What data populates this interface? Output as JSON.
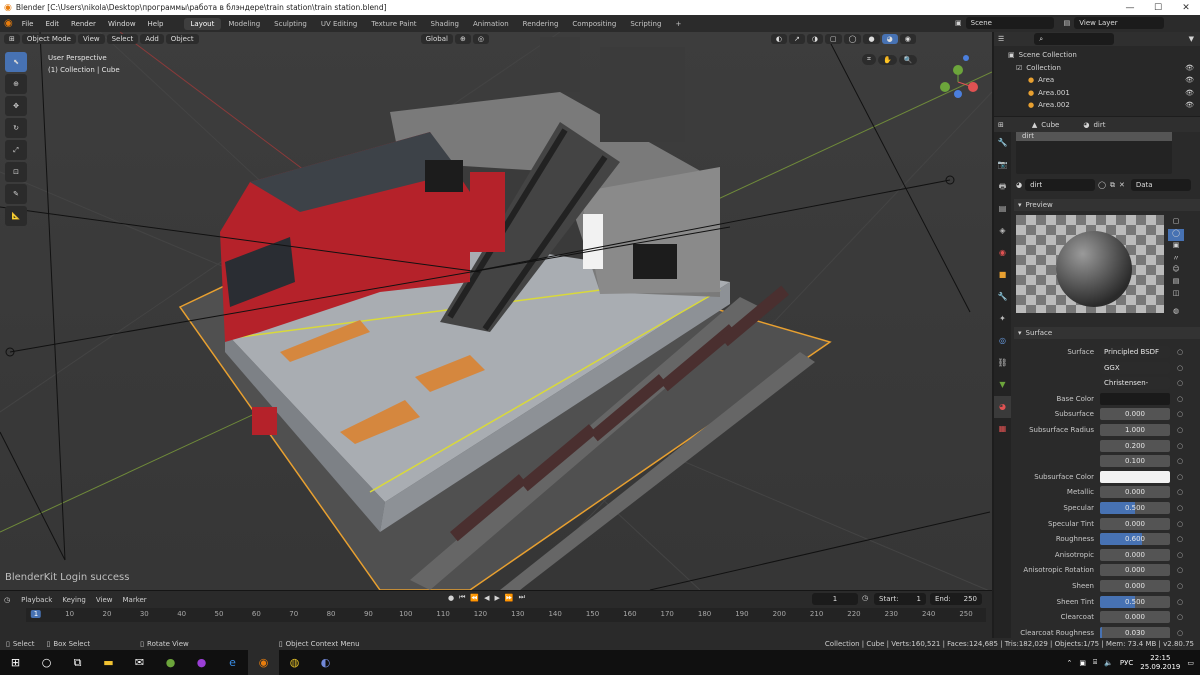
{
  "titlebar": {
    "title": "Blender [C:\\Users\\nikola\\Desktop\\программы\\работа в блэндере\\train station\\train station.blend]",
    "minimize": "—",
    "maximize": "☐",
    "close": "✕"
  },
  "menu": [
    "File",
    "Edit",
    "Render",
    "Window",
    "Help"
  ],
  "workspaces": [
    "Layout",
    "Modeling",
    "Sculpting",
    "UV Editing",
    "Texture Paint",
    "Shading",
    "Animation",
    "Rendering",
    "Compositing",
    "Scripting",
    "+"
  ],
  "scene": {
    "label": "Scene",
    "view_layer": "View Layer"
  },
  "viewport": {
    "mode": "Object Mode",
    "menus": [
      "View",
      "Select",
      "Add",
      "Object"
    ],
    "orientation": "Global",
    "perspective": "User Perspective",
    "collection": "(1) Collection | Cube",
    "notice": "BlenderKit Login success"
  },
  "outliner": {
    "root": "Scene Collection",
    "collection": "Collection",
    "items": [
      "Area",
      "Area.001",
      "Area.002"
    ],
    "search_placeholder": ""
  },
  "properties": {
    "object": "Cube",
    "material": "dirt",
    "slot": "dirt",
    "material_field": "dirt",
    "data_label": "Data",
    "preview_label": "Preview",
    "surface_label": "Surface",
    "rows": [
      {
        "label": "Surface",
        "value": "Principled BSDF",
        "kind": "dropdown"
      },
      {
        "label": "",
        "value": "GGX",
        "kind": "dropdown"
      },
      {
        "label": "",
        "value": "Christensen-Burley",
        "kind": "dropdown"
      },
      {
        "label": "Base Color",
        "value": "",
        "kind": "swatch-dark"
      },
      {
        "label": "Subsurface",
        "value": "0.000",
        "kind": "num",
        "fill": 0
      },
      {
        "label": "Subsurface Radius",
        "value": "1.000",
        "kind": "num",
        "fill": 0
      },
      {
        "label": "",
        "value": "0.200",
        "kind": "num",
        "fill": 0
      },
      {
        "label": "",
        "value": "0.100",
        "kind": "num",
        "fill": 0
      },
      {
        "label": "Subsurface Color",
        "value": "",
        "kind": "swatch-light"
      },
      {
        "label": "Metallic",
        "value": "0.000",
        "kind": "num",
        "fill": 0
      },
      {
        "label": "Specular",
        "value": "0.500",
        "kind": "num",
        "fill": 0.5
      },
      {
        "label": "Specular Tint",
        "value": "0.000",
        "kind": "num",
        "fill": 0
      },
      {
        "label": "Roughness",
        "value": "0.600",
        "kind": "num",
        "fill": 0.6
      },
      {
        "label": "Anisotropic",
        "value": "0.000",
        "kind": "num",
        "fill": 0
      },
      {
        "label": "Anisotropic Rotation",
        "value": "0.000",
        "kind": "num",
        "fill": 0
      },
      {
        "label": "Sheen",
        "value": "0.000",
        "kind": "num",
        "fill": 0
      },
      {
        "label": "Sheen Tint",
        "value": "0.500",
        "kind": "num",
        "fill": 0.5
      },
      {
        "label": "Clearcoat",
        "value": "0.000",
        "kind": "num",
        "fill": 0
      },
      {
        "label": "Clearcoat Roughness",
        "value": "0.030",
        "kind": "num",
        "fill": 0.03
      }
    ]
  },
  "timeline": {
    "menus": [
      "Playback",
      "Keying",
      "View",
      "Marker"
    ],
    "current_frame": "1",
    "start_label": "Start:",
    "start": "1",
    "end_label": "End:",
    "end": "250",
    "ticks": [
      "1",
      "10",
      "20",
      "30",
      "40",
      "50",
      "60",
      "70",
      "80",
      "90",
      "100",
      "110",
      "120",
      "130",
      "140",
      "150",
      "160",
      "170",
      "180",
      "190",
      "200",
      "210",
      "220",
      "230",
      "240",
      "250"
    ]
  },
  "statusbar": {
    "select": "Select",
    "box_select": "Box Select",
    "rotate_view": "Rotate View",
    "context_menu": "Object Context Menu",
    "stats": "Collection | Cube | Verts:160,521 | Faces:124,685 | Tris:182,029 | Objects:1/75 | Mem: 73.4 MB | v2.80.75"
  },
  "taskbar": {
    "lang": "РУС",
    "time": "22:15",
    "date": "25.09.2019"
  },
  "colors": {
    "accent": "#4772b3",
    "orange_outline": "#e8a030"
  }
}
